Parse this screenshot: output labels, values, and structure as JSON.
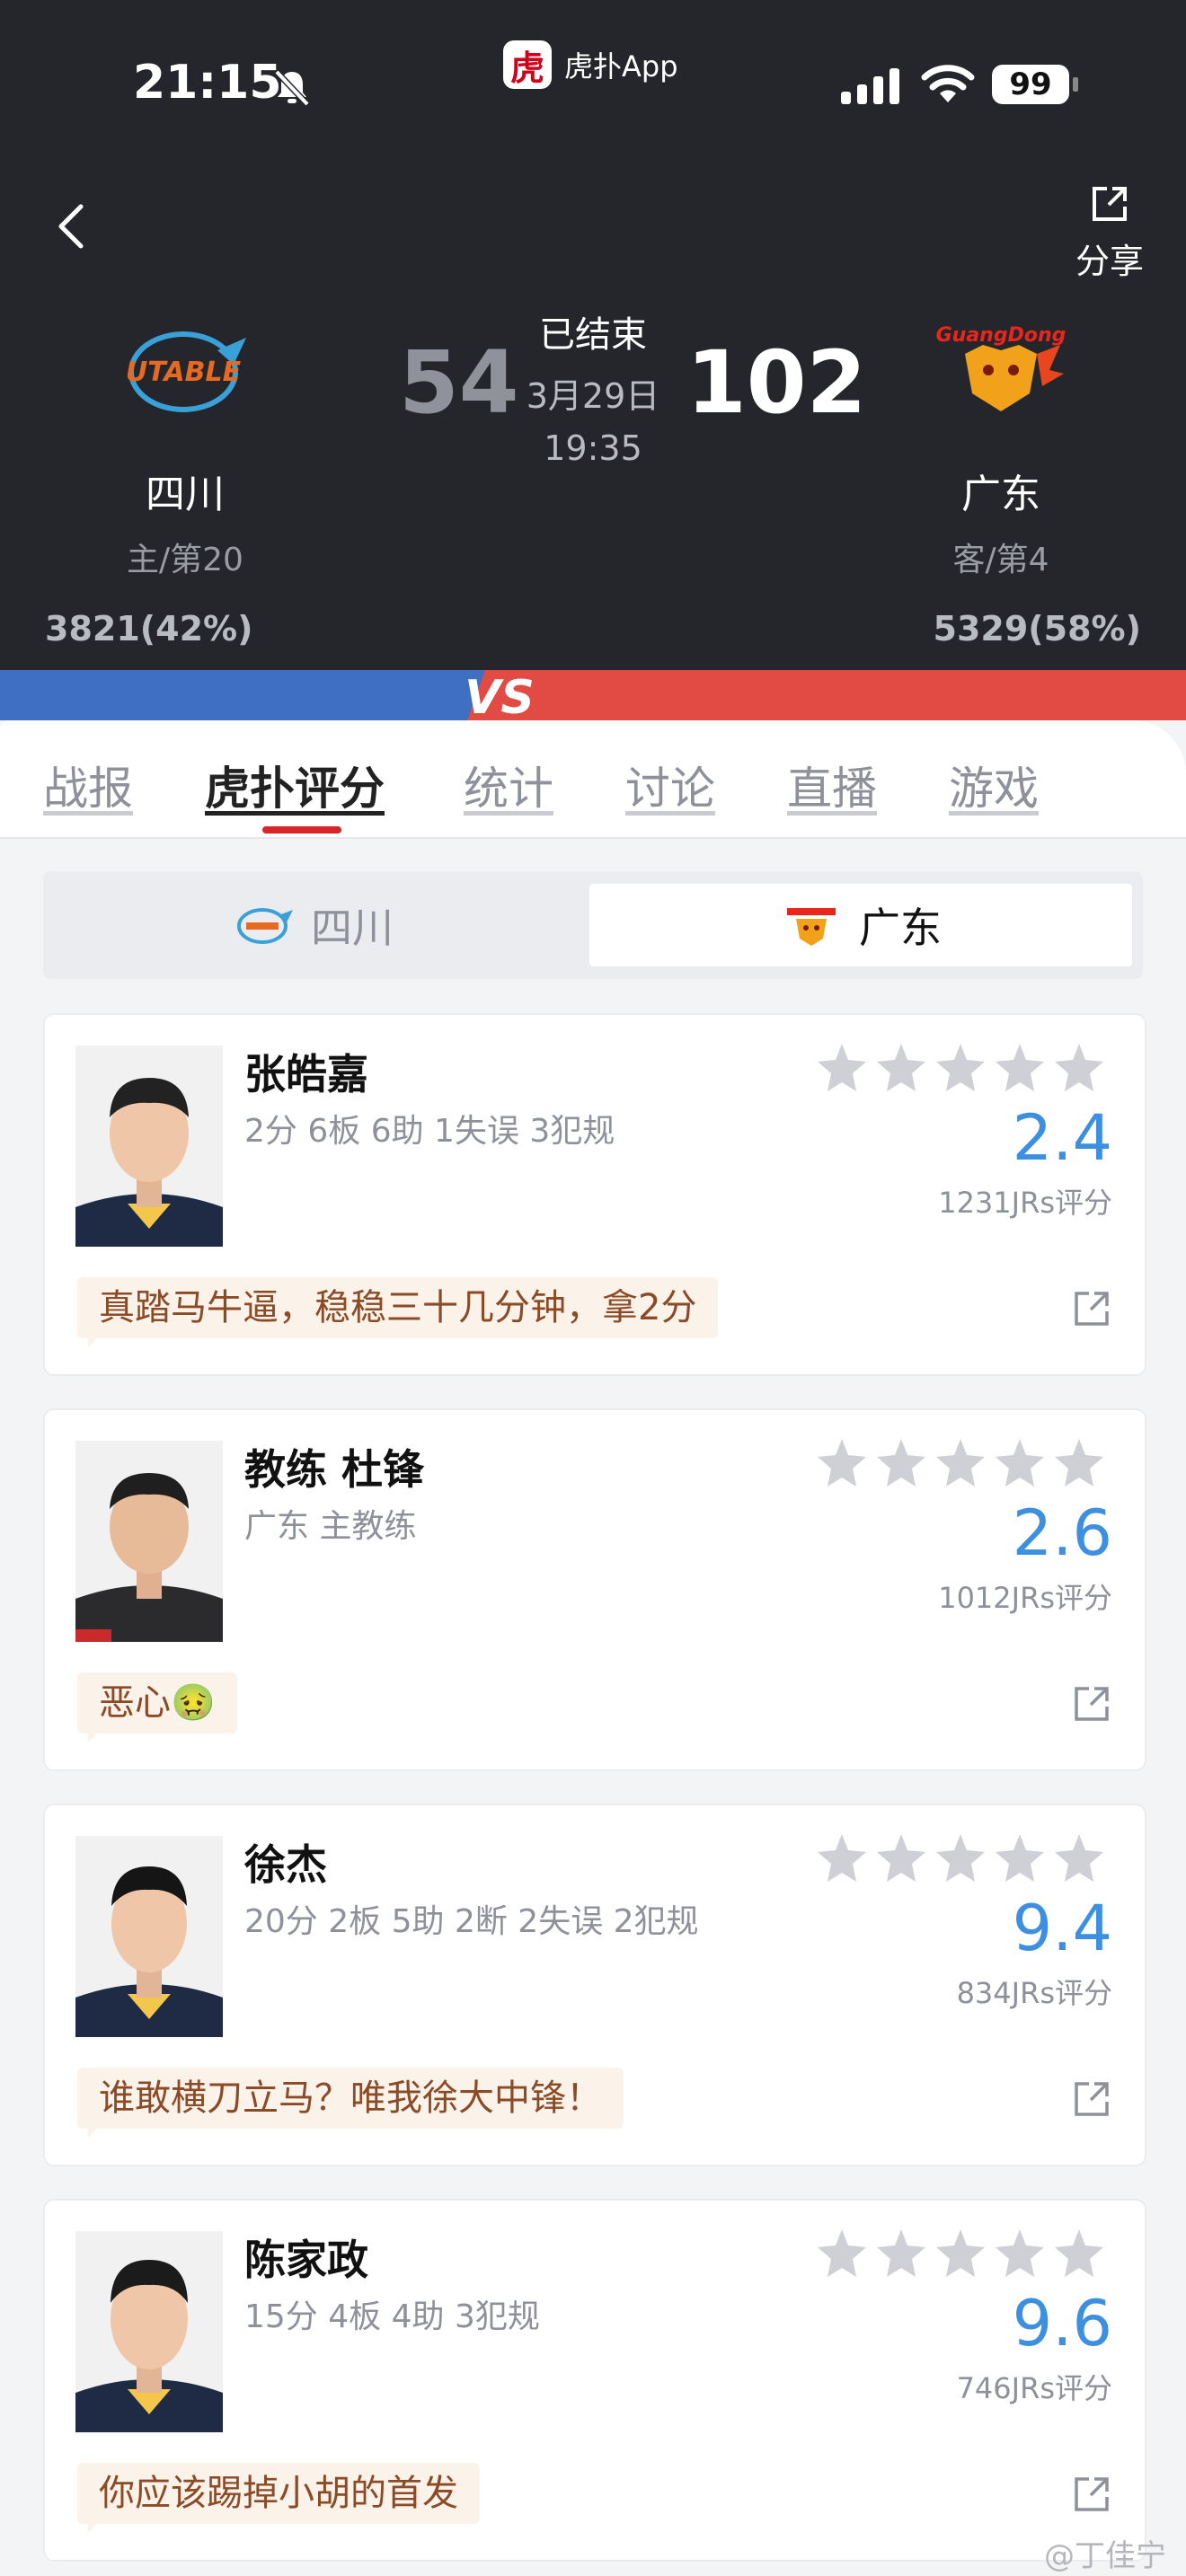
{
  "status_bar": {
    "time": "21:15",
    "battery": "99",
    "app_name": "虎扑App",
    "app_logo_char": "虎"
  },
  "header": {
    "share_label": "分享"
  },
  "game": {
    "state": "已结束",
    "date": "3月29日",
    "time": "19:35",
    "home": {
      "name": "四川",
      "rank": "主/第20",
      "score": "54",
      "votes": "3821(42%)",
      "logo_text": "UTABLE"
    },
    "away": {
      "name": "广东",
      "rank": "客/第4",
      "score": "102",
      "votes": "5329(58%)",
      "logo_text": "GuangDong"
    },
    "vs_label": "VS"
  },
  "tabs": [
    {
      "label": "战报"
    },
    {
      "label": "虎扑评分"
    },
    {
      "label": "统计"
    },
    {
      "label": "讨论"
    },
    {
      "label": "直播"
    },
    {
      "label": "游戏"
    }
  ],
  "team_toggle": {
    "left": "四川",
    "right": "广东",
    "selected": "广东"
  },
  "colors": {
    "accent": "#d7262a",
    "score_blue": "#3d8fe0",
    "comment_bg": "#fbf2ea",
    "comment_text": "#8a4b26",
    "vs_blue": "#3f6fc2",
    "vs_red": "#e24a44"
  },
  "ratings": [
    {
      "name": "张皓嘉",
      "stats": "2分 6板 6助 1失误 3犯规",
      "score": "2.4",
      "count": "1231JRs评分",
      "comment": "真踏马牛逼，稳稳三十几分钟，拿2分",
      "icon": "player-photo"
    },
    {
      "name": "教练 杜锋",
      "stats": "广东 主教练",
      "score": "2.6",
      "count": "1012JRs评分",
      "comment": "恶心🤢",
      "icon": "coach-photo"
    },
    {
      "name": "徐杰",
      "stats": "20分 2板 5助 2断 2失误 2犯规",
      "score": "9.4",
      "count": "834JRs评分",
      "comment": "谁敢横刀立马？唯我徐大中锋！",
      "icon": "player-photo"
    },
    {
      "name": "陈家政",
      "stats": "15分 4板 4助 3犯规",
      "score": "9.6",
      "count": "746JRs评分",
      "comment": "你应该踢掉小胡的首发",
      "icon": "player-photo"
    }
  ],
  "watermark": "@丁佳宁"
}
